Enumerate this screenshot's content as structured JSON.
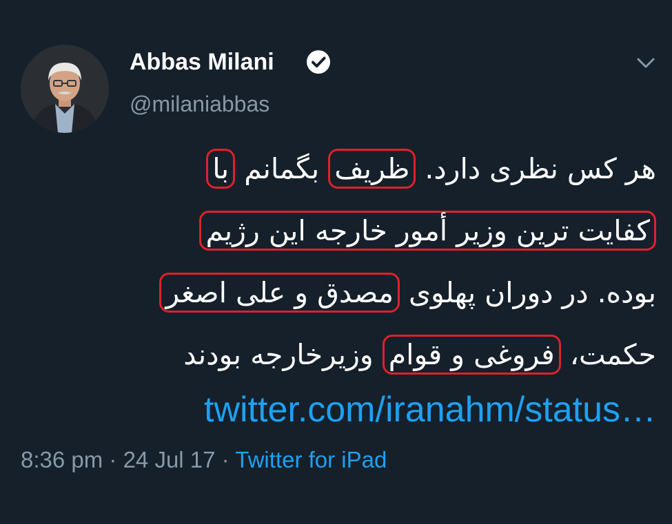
{
  "author": {
    "display_name": "Abbas Milani",
    "handle": "@milaniabbas"
  },
  "tweet": {
    "lines": [
      {
        "before": "هر کس نظری دارد. ",
        "hl1": "ظریف",
        "middle": " بگمانم ",
        "hl2": "با"
      },
      {
        "hl": "کفایت ترین وزیر أمور خارجه این رژیم"
      },
      {
        "before": "بوده. در دوران پهلوی ",
        "hl": "مصدق و علی اصغر"
      },
      {
        "before": "حکمت، ",
        "hl": "فروغی و قوام",
        "after": " وزیرخارجه بودند"
      }
    ],
    "link": "twitter.com/iranahm/status…"
  },
  "meta": {
    "time": "8:36 pm",
    "separator": " · ",
    "date": "24 Jul 17",
    "source": "Twitter for iPad"
  },
  "colors": {
    "background": "#15202b",
    "text": "#ffffff",
    "secondary": "#8899a6",
    "link": "#1da1f2",
    "highlight_box": "#e0202a"
  },
  "icons": [
    "verified-badge-icon",
    "chevron-down-icon"
  ]
}
